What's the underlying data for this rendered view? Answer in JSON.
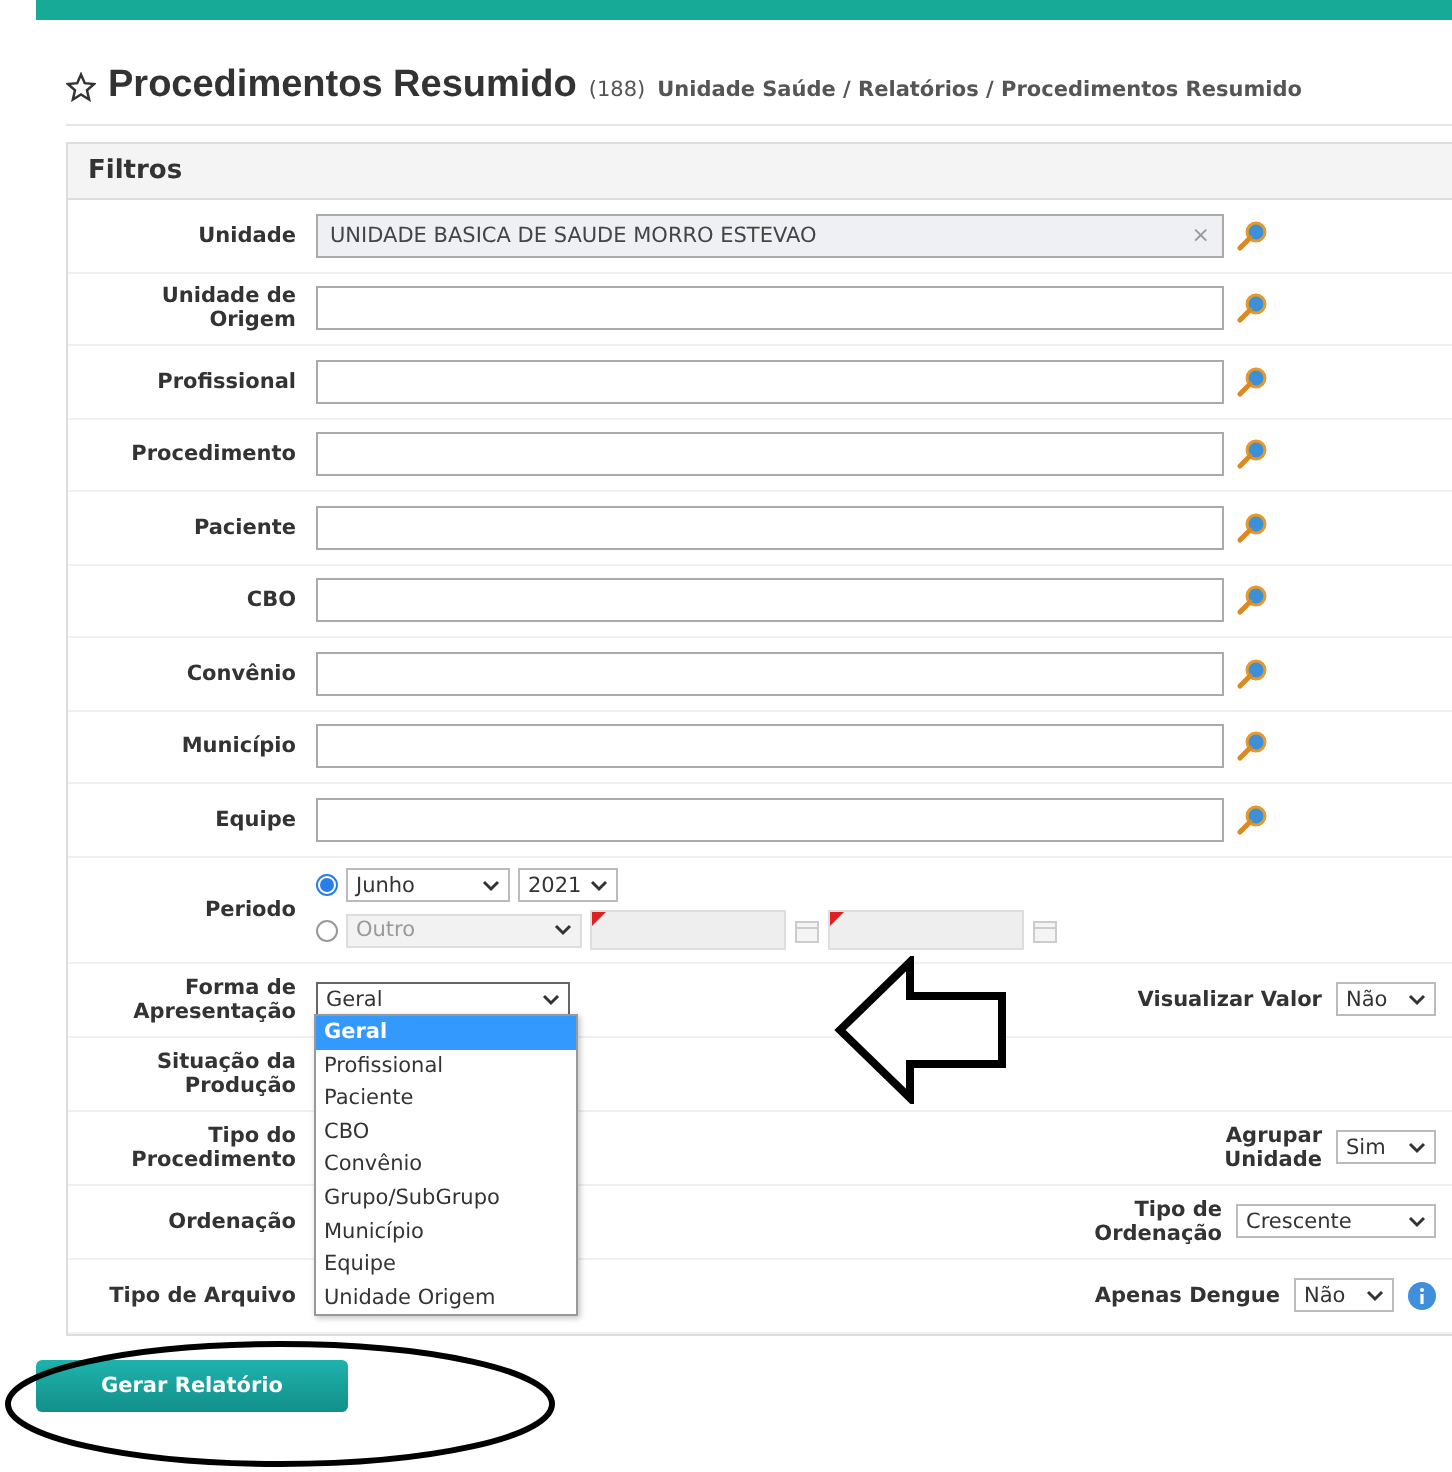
{
  "header": {
    "title": "Procedimentos Resumido",
    "count": "(188)",
    "breadcrumb": "Unidade Saúde / Relatórios / Procedimentos Resumido"
  },
  "filters": {
    "title": "Filtros",
    "lookups": [
      {
        "label": "Unidade",
        "value": "UNIDADE BASICA DE SAUDE MORRO ESTEVAO",
        "clear": "×"
      },
      {
        "label": "Unidade de Origem"
      },
      {
        "label": "Profissional"
      },
      {
        "label": "Procedimento"
      },
      {
        "label": "Paciente"
      },
      {
        "label": "CBO"
      },
      {
        "label": "Convênio"
      },
      {
        "label": "Município"
      },
      {
        "label": "Equipe"
      }
    ],
    "period": {
      "label": "Periodo",
      "choices": [
        {
          "kind": "month",
          "selected": true,
          "month": "Junho",
          "year": "2021"
        },
        {
          "kind": "range",
          "selected": false,
          "value": "Outro"
        }
      ]
    },
    "options": [
      {
        "label": "Forma de Apresentação",
        "select": {
          "value": "Geral",
          "expanded": true,
          "options": [
            {
              "label": "Geral",
              "selected": true
            },
            {
              "label": "Profissional",
              "selected": false
            },
            {
              "label": "Paciente",
              "selected": false
            },
            {
              "label": "CBO",
              "selected": false
            },
            {
              "label": "Convênio",
              "selected": false
            },
            {
              "label": "Grupo/SubGrupo",
              "selected": false
            },
            {
              "label": "Município",
              "selected": false
            },
            {
              "label": "Equipe",
              "selected": false
            },
            {
              "label": "Unidade Origem",
              "selected": false
            }
          ]
        },
        "right": {
          "label": "Visualizar Valor",
          "value": "Não"
        }
      },
      {
        "label": "Situação da Produção"
      },
      {
        "label": "Tipo do Procedimento",
        "right": {
          "label": "Agrupar\nUnidade",
          "value": "Sim"
        }
      },
      {
        "label": "Ordenação",
        "right": {
          "label": "Tipo de\nOrdenação",
          "value": "Crescente"
        }
      },
      {
        "label": "Tipo de Arquivo",
        "right": {
          "label": "Apenas Dengue",
          "value": "Não",
          "info": true
        }
      }
    ]
  },
  "submit": "Gerar Relatório"
}
